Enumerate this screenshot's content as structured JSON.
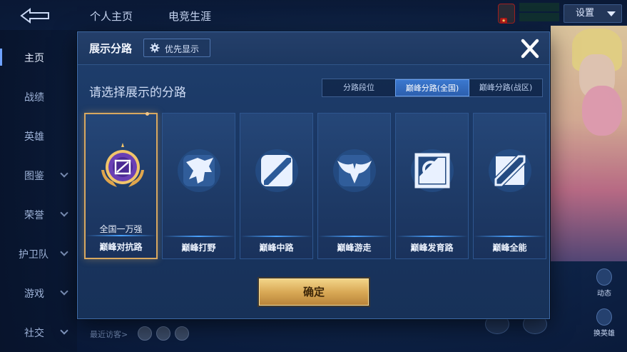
{
  "background": {
    "tabs": [
      "个人主页",
      "电竞生涯"
    ],
    "settings_label": "设置",
    "sidebar": [
      {
        "label": "主页",
        "active": true,
        "chevron": false
      },
      {
        "label": "战绩",
        "active": false,
        "chevron": false
      },
      {
        "label": "英雄",
        "active": false,
        "chevron": false
      },
      {
        "label": "图鉴",
        "active": false,
        "chevron": true
      },
      {
        "label": "荣誉",
        "active": false,
        "chevron": true
      },
      {
        "label": "护卫队",
        "active": false,
        "chevron": true
      },
      {
        "label": "游戏",
        "active": false,
        "chevron": true
      },
      {
        "label": "社交",
        "active": false,
        "chevron": true
      }
    ],
    "recent_visitor": "最近访客>",
    "right_buttons": [
      "动态",
      "换英雄"
    ]
  },
  "modal": {
    "title": "展示分路",
    "priority_label": "优先显示",
    "close_icon": "close-icon",
    "subtitle": "请选择展示的分路",
    "segments": [
      {
        "label": "分路段位",
        "selected": false
      },
      {
        "label": "巅峰分路(全国)",
        "selected": true
      },
      {
        "label": "巅峰分路(战区)",
        "selected": false
      }
    ],
    "cards": [
      {
        "name": "巅峰对抗路",
        "rank": "全国一万强",
        "selected": true,
        "icon": "clash-lane-medal-icon"
      },
      {
        "name": "巅峰打野",
        "rank": "",
        "selected": false,
        "icon": "jungle-dragon-icon"
      },
      {
        "name": "巅峰中路",
        "rank": "",
        "selected": false,
        "icon": "mid-lane-icon"
      },
      {
        "name": "巅峰游走",
        "rank": "",
        "selected": false,
        "icon": "roam-wings-icon"
      },
      {
        "name": "巅峰发育路",
        "rank": "",
        "selected": false,
        "icon": "farm-lane-icon"
      },
      {
        "name": "巅峰全能",
        "rank": "",
        "selected": false,
        "icon": "all-round-icon"
      }
    ],
    "confirm_label": "确定"
  },
  "colors": {
    "panel": "#1a3764",
    "segment_selected": "#3b78cf",
    "card_selected_border": "#d8a860",
    "confirm_gold": "#d9a956"
  }
}
